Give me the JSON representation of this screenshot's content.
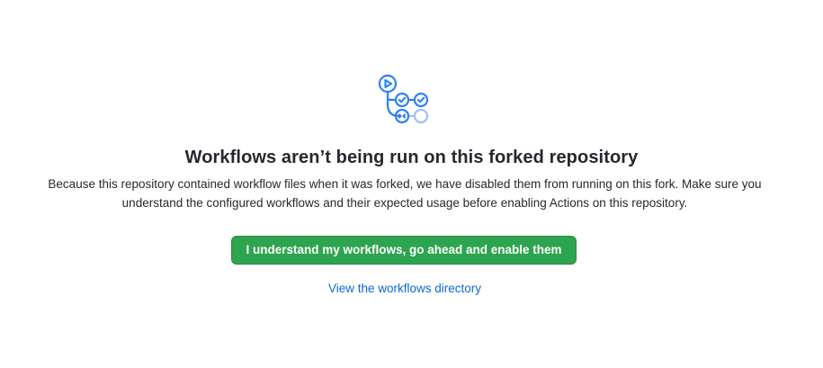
{
  "blankslate": {
    "icon": "workflow-icon",
    "title": "Workflows aren’t being run on this forked repository",
    "description": "Because this repository contained workflow files when it was forked, we have disabled them from running on this fork. Make sure you understand the configured workflows and their expected usage before enabling Actions on this repository.",
    "primary_button_label": "I understand my workflows, go ahead and enable them",
    "secondary_link_label": "View the workflows directory"
  },
  "colors": {
    "primary_button_bg": "#2da44e",
    "link": "#0969da",
    "icon_accent": "#2f81f7",
    "icon_muted": "#9ec1f7"
  }
}
